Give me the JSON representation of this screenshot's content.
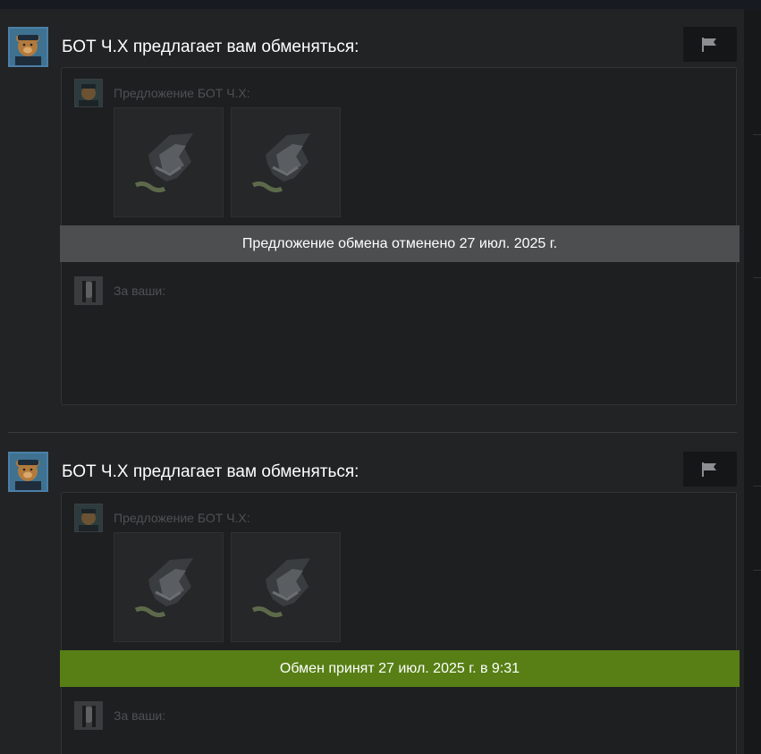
{
  "offers": [
    {
      "title": "БОТ Ч.Х предлагает вам обменяться:",
      "their_label": "Предложение БОТ Ч.Х:",
      "your_label": "За ваши:",
      "items": [
        "item-1",
        "item-2"
      ],
      "status": "Предложение обмена отменено 27 июл. 2025 г.",
      "status_type": "cancelled",
      "status_color": "#4d4e50"
    },
    {
      "title": "БОТ Ч.Х предлагает вам обменяться:",
      "their_label": "Предложение БОТ Ч.Х:",
      "your_label": "За ваши:",
      "items": [
        "item-1",
        "item-2"
      ],
      "status": "Обмен принят 27 июл. 2025 г. в 9:31",
      "status_type": "accepted",
      "status_color": "#577f15"
    }
  ],
  "icons": {
    "flag": "flag-icon",
    "bot_avatar": "bear-avatar-icon",
    "user_avatar": "user-avatar-icon",
    "item": "wolf-logo-icon"
  },
  "colors": {
    "accent": "#5b87b5",
    "accepted": "#577f15",
    "cancelled": "#4d4e50"
  }
}
